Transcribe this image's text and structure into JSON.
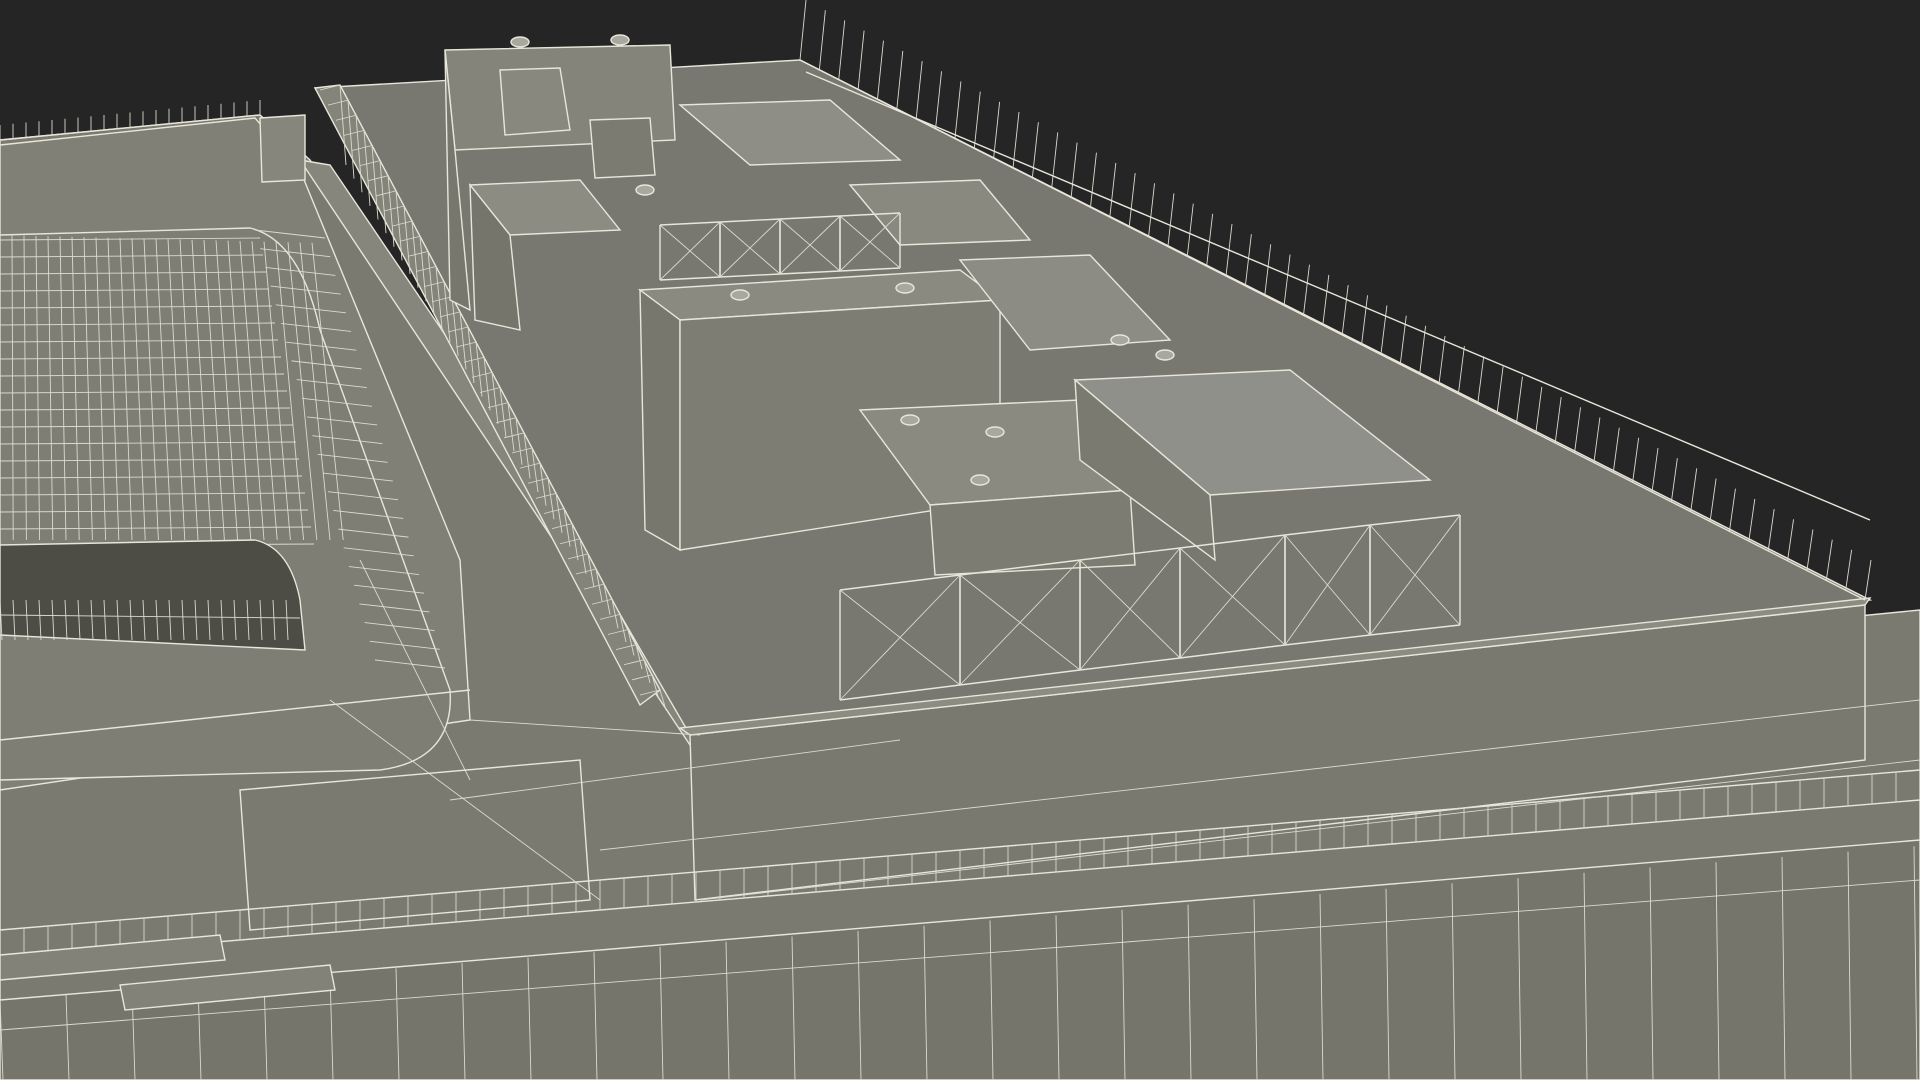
{
  "scene": {
    "background_color": "#252525",
    "surface_color": "#7b7b71",
    "surface_dark_color": "#6e6e64",
    "surface_light_color": "#8a8a80",
    "wire_color": "#e8e6da"
  }
}
